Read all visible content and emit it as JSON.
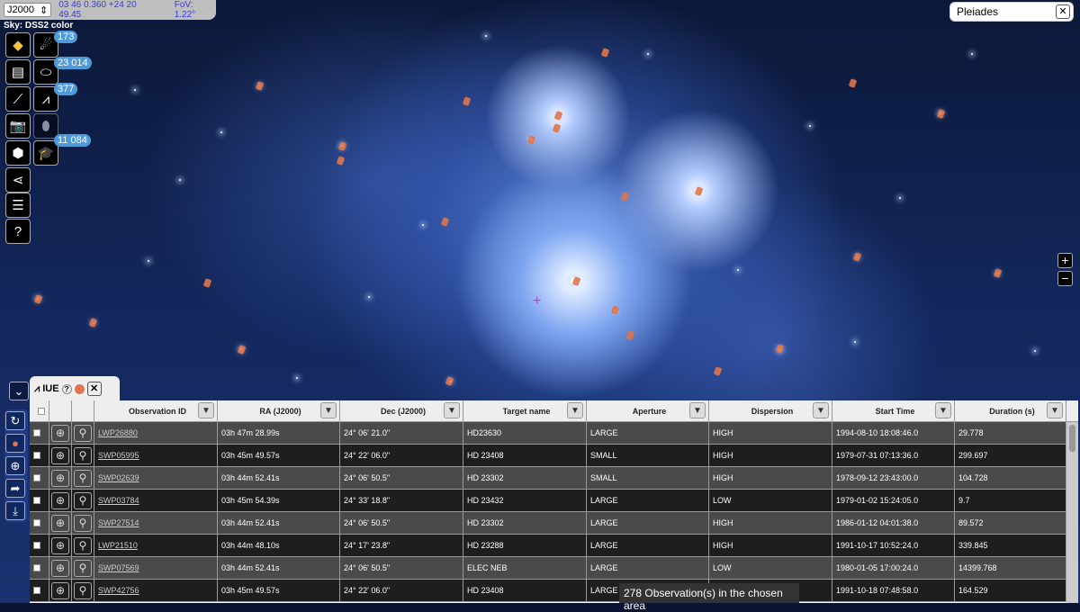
{
  "topbar": {
    "frame": "J2000",
    "coords": "03 46 0.360 +24 20 49.45",
    "fov": "FoV: 1.22°"
  },
  "survey": "Sky: DSS2 color",
  "toolbar": {
    "badges": [
      "173",
      "23 014",
      "377",
      "11 084"
    ]
  },
  "search": {
    "value": "Pleiades",
    "clear": "✕"
  },
  "zoom": {
    "plus": "+",
    "minus": "−"
  },
  "panel": {
    "tab_title": "IUE",
    "help": "?",
    "close": "✕",
    "marker_color": "#e0744a",
    "status": "278 Observation(s) in the chosen area"
  },
  "table": {
    "columns": [
      "Observation ID",
      "RA (J2000)",
      "Dec (J2000)",
      "Target name",
      "Aperture",
      "Dispersion",
      "Start Time",
      "Duration (s)"
    ],
    "rows": [
      [
        "LWP26880",
        "03h 47m 28.99s",
        "24° 06' 21.0\"",
        "HD23630",
        "LARGE",
        "HIGH",
        "1994-08-10 18:08:46.0",
        "29.778"
      ],
      [
        "SWP05995",
        "03h 45m 49.57s",
        "24° 22' 06.0\"",
        "HD 23408",
        "SMALL",
        "HIGH",
        "1979-07-31 07:13:36.0",
        "299.697"
      ],
      [
        "SWP02639",
        "03h 44m 52.41s",
        "24° 06' 50.5\"",
        "HD 23302",
        "SMALL",
        "HIGH",
        "1978-09-12 23:43:00.0",
        "104.728"
      ],
      [
        "SWP03784",
        "03h 45m 54.39s",
        "24° 33' 18.8\"",
        "HD 23432",
        "LARGE",
        "LOW",
        "1979-01-02 15:24:05.0",
        "9.7"
      ],
      [
        "SWP27514",
        "03h 44m 52.41s",
        "24° 06' 50.5\"",
        "HD 23302",
        "LARGE",
        "HIGH",
        "1986-01-12 04:01:38.0",
        "89.572"
      ],
      [
        "LWP21510",
        "03h 44m 48.10s",
        "24° 17' 23.8\"",
        "HD 23288",
        "LARGE",
        "HIGH",
        "1991-10-17 10:52:24.0",
        "339.845"
      ],
      [
        "SWP07569",
        "03h 44m 52.41s",
        "24° 06' 50.5\"",
        "ELEC NEB",
        "LARGE",
        "LOW",
        "1980-01-05 17:00:24.0",
        "14399.768"
      ],
      [
        "SWP42756",
        "03h 45m 49.57s",
        "24° 22' 06.0\"",
        "HD 23408",
        "LARGE",
        "HIGH",
        "1991-10-18 07:48:58.0",
        "164.529"
      ]
    ]
  }
}
